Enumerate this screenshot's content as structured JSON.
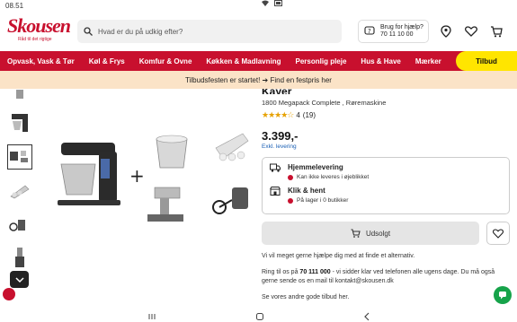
{
  "status": {
    "time": "08.51",
    "icons": "signal wifi battery"
  },
  "header": {
    "logo_text": "Skousen",
    "logo_tagline": "Råd til det rigtige",
    "search_placeholder": "Hvad er du på udkig efter?",
    "help_line1": "Brug for hjælp?",
    "help_line2": "70 11 10 00"
  },
  "nav": {
    "items": [
      "Opvask, Vask & Tør",
      "Køl & Frys",
      "Komfur & Ovne",
      "Køkken & Madlavning",
      "Personlig pleje",
      "Hus & Have",
      "Mærker"
    ],
    "tilbud": "Tilbud"
  },
  "banner": {
    "text": "Tilbudsfesten er startet! ➔ Find en festpris her"
  },
  "product": {
    "title_partial": "Kayer",
    "subtitle": "1800 Megapack Complete , Røremaskine",
    "stars": "★★★★☆",
    "rating": "4",
    "reviews": "(19)",
    "price": "3.399,-",
    "vat_note": "Exkl. levering"
  },
  "delivery": {
    "home_title": "Hjemmelevering",
    "home_status": "Kan ikke leveres i øjeblikket",
    "pickup_title": "Klik & hent",
    "pickup_status": "På lager i 0 butikker"
  },
  "actions": {
    "soldout_label": "Udsolgt"
  },
  "info": {
    "p1": "Vi vil meget gerne hjælpe dig med at finde et alternativ.",
    "p2_pre": "Ring til os på ",
    "p2_phone": "70 111 000",
    "p2_post": " - vi sidder klar ved telefonen alle ugens dage. Du må også gerne sende os en mail til kontakt@skousen.dk",
    "p3": "Se vores andre gode tilbud her."
  },
  "colors": {
    "brand_red": "#c8102e",
    "tilbud_yellow": "#ffe500",
    "banner_bg": "#fbe3c7",
    "chat_green": "#16a34a"
  }
}
